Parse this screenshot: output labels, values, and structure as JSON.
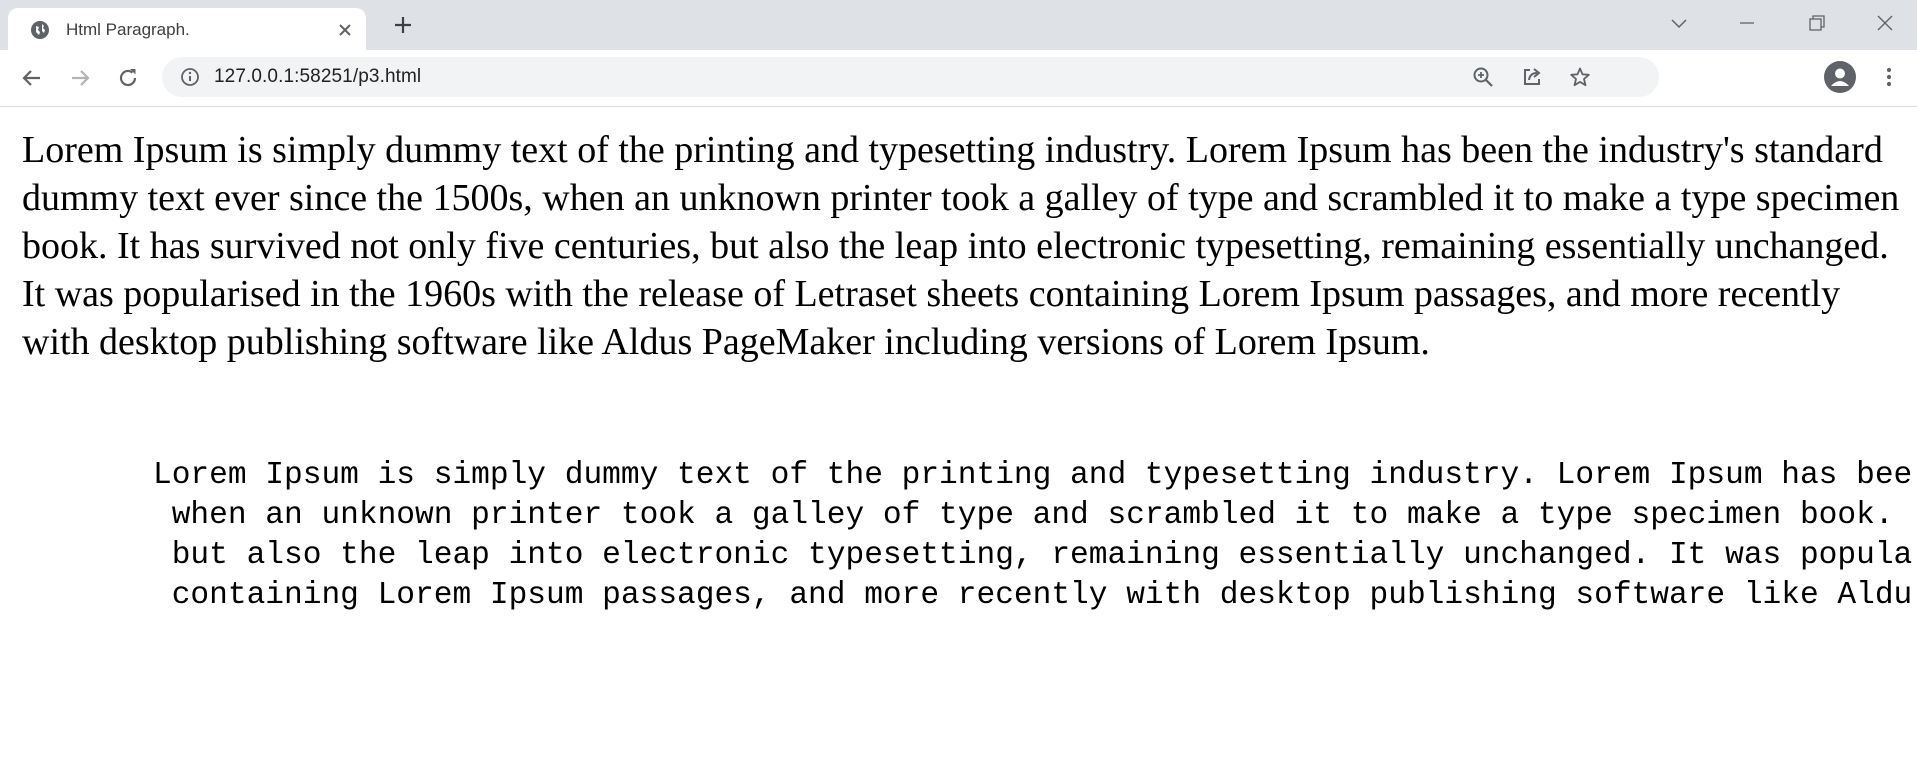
{
  "browser": {
    "tab": {
      "title": "Html Paragraph.",
      "favicon": "globe-icon"
    },
    "new_tab_icon": "plus-icon",
    "window_controls": [
      "chevron-down-icon",
      "minimize-icon",
      "restore-icon",
      "close-icon"
    ],
    "address_bar": {
      "url": "127.0.0.1:58251/p3.html",
      "site_info_icon": "info-icon",
      "actions": [
        "zoom-icon",
        "share-icon",
        "star-icon"
      ]
    },
    "nav": [
      "back-arrow-icon",
      "forward-arrow-icon",
      "reload-icon"
    ],
    "profile_icon": "person-icon",
    "menu_icon": "kebab-menu-icon"
  },
  "page": {
    "paragraph": "Lorem Ipsum is simply dummy text of the printing and typesetting industry. Lorem Ipsum has been the industry's standard dummy text ever since the 1500s, when an unknown printer took a galley of type and scrambled it to make a type specimen book. It has survived not only five centuries, but also the leap into electronic typesetting, remaining essentially unchanged. It was popularised in the 1960s with the release of Letraset sheets containing Lorem Ipsum passages, and more recently with desktop publishing software like Aldus PageMaker including versions of Lorem Ipsum.",
    "preformatted": "Lorem Ipsum is simply dummy text of the printing and typesetting industry. Lorem Ipsum has bee\n when an unknown printer took a galley of type and scrambled it to make a type specimen book.\n but also the leap into electronic typesetting, remaining essentially unchanged. It was popula\n containing Lorem Ipsum passages, and more recently with desktop publishing software like Aldu"
  },
  "colors": {
    "tabstrip": "#dee1e6",
    "omnibox": "#f1f3f4",
    "icon": "#5f6368",
    "text": "#000000"
  }
}
